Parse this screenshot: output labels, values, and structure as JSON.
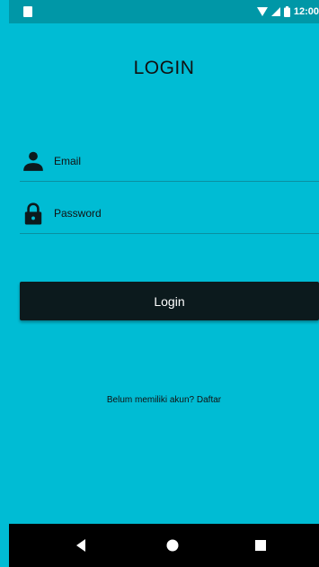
{
  "status_bar": {
    "time": "12:00",
    "icons": [
      "sim-icon",
      "wifi-icon",
      "signal-icon",
      "battery-icon"
    ]
  },
  "title": "LOGIN",
  "form": {
    "email": {
      "placeholder": "Email",
      "icon": "person-icon"
    },
    "password": {
      "placeholder": "Password",
      "icon": "lock-icon"
    }
  },
  "login_button_label": "Login",
  "register_text": "Belum memiliki akun? Daftar",
  "nav_bar": {
    "buttons": [
      "back-icon",
      "home-icon",
      "recent-apps-icon"
    ]
  },
  "colors": {
    "background": "#00bcd4",
    "status_bar": "#0097a7",
    "button": "#0c1a1d",
    "nav_bar": "#000000"
  }
}
